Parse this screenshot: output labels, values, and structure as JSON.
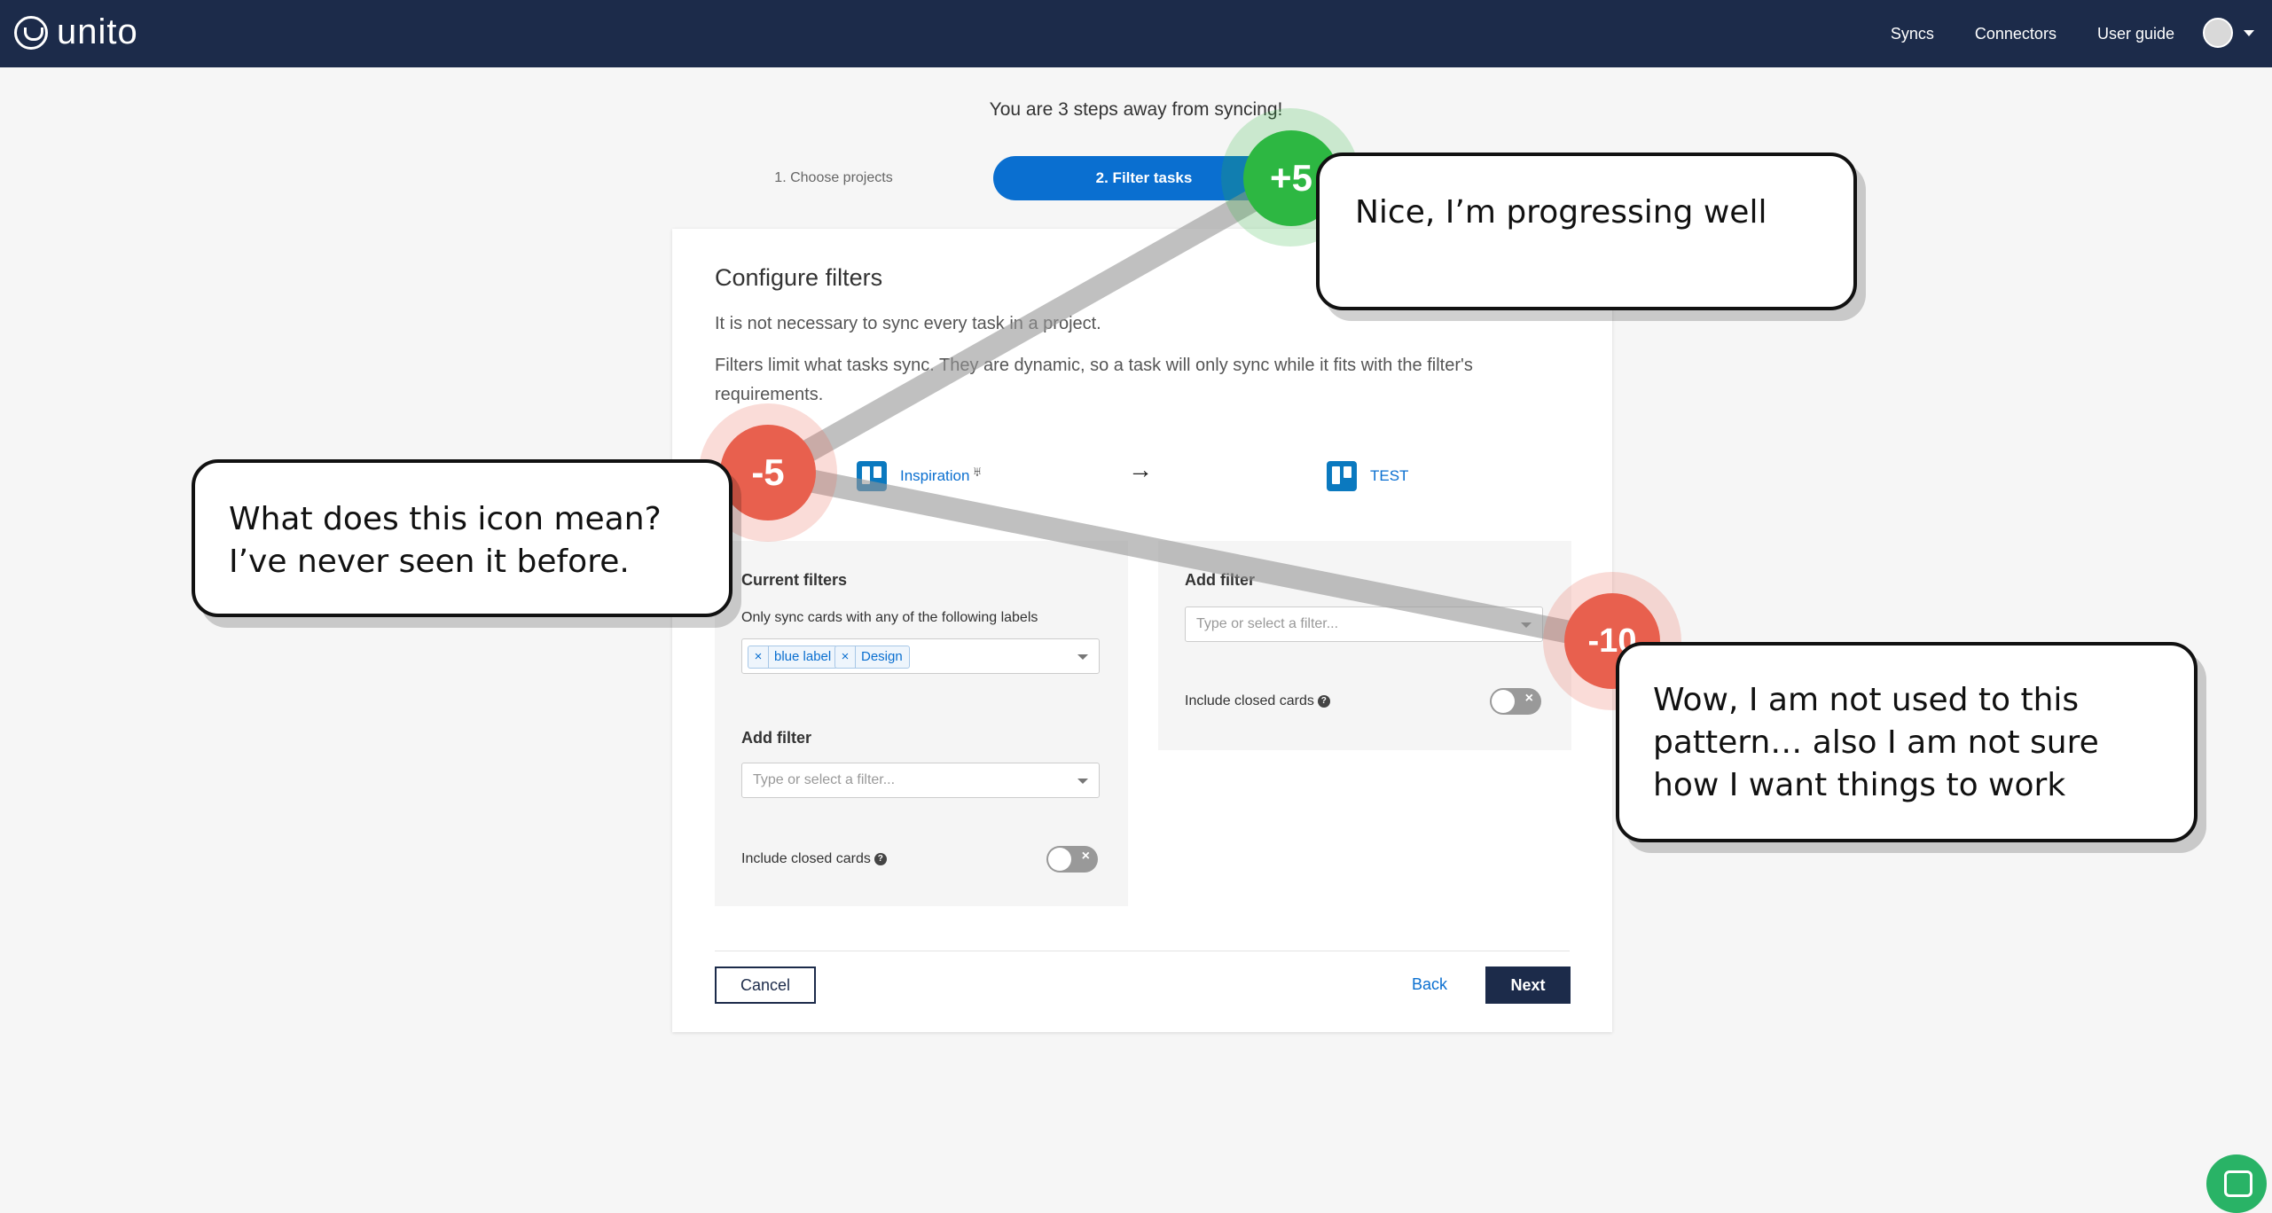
{
  "nav": {
    "logo": "unito",
    "links": [
      "Syncs",
      "Connectors",
      "User guide"
    ]
  },
  "steps": {
    "title": "You are 3 steps away from syncing!",
    "step1": "1. Choose projects",
    "step2": "2. Filter tasks"
  },
  "card": {
    "title": "Configure filters",
    "p1": "It is not necessary to sync every task in a project.",
    "p2": "Filters limit what tasks sync. They are dynamic, so a task will only sync while it fits with the filter's requirements.",
    "left_project": "Inspiration",
    "right_project": "TEST",
    "arrow": "→",
    "odd_icon": "♅"
  },
  "left_panel": {
    "current_filters": "Current filters",
    "rule": "Only sync cards with any of the following labels",
    "tags": [
      "blue label",
      "Design"
    ],
    "add_filter": "Add filter",
    "placeholder": "Type or select a filter...",
    "include_closed": "Include closed cards"
  },
  "right_panel": {
    "add_filter": "Add filter",
    "placeholder": "Type or select a filter...",
    "include_closed": "Include closed cards"
  },
  "buttons": {
    "cancel": "Cancel",
    "back": "Back",
    "next": "Next"
  },
  "annotations": {
    "badges": [
      "+5",
      "-5",
      "-10"
    ],
    "bubble_top": "Nice, I’m progressing well",
    "bubble_left_1": "What does this icon mean?",
    "bubble_left_2": "I’ve never seen it before.",
    "bubble_right_1": "Wow, I am not used to this",
    "bubble_right_2": "pattern… also I am not sure",
    "bubble_right_3": "how I want things to work"
  },
  "colors": {
    "nav": "#1c2b4a",
    "primary": "#0a6fd0",
    "positive": "#2db742",
    "negative": "#e8604e"
  },
  "icons": [
    "unito-logo-icon",
    "avatar-icon",
    "trello-board-icon",
    "arrow-right-icon",
    "help-icon",
    "chat-icon"
  ]
}
